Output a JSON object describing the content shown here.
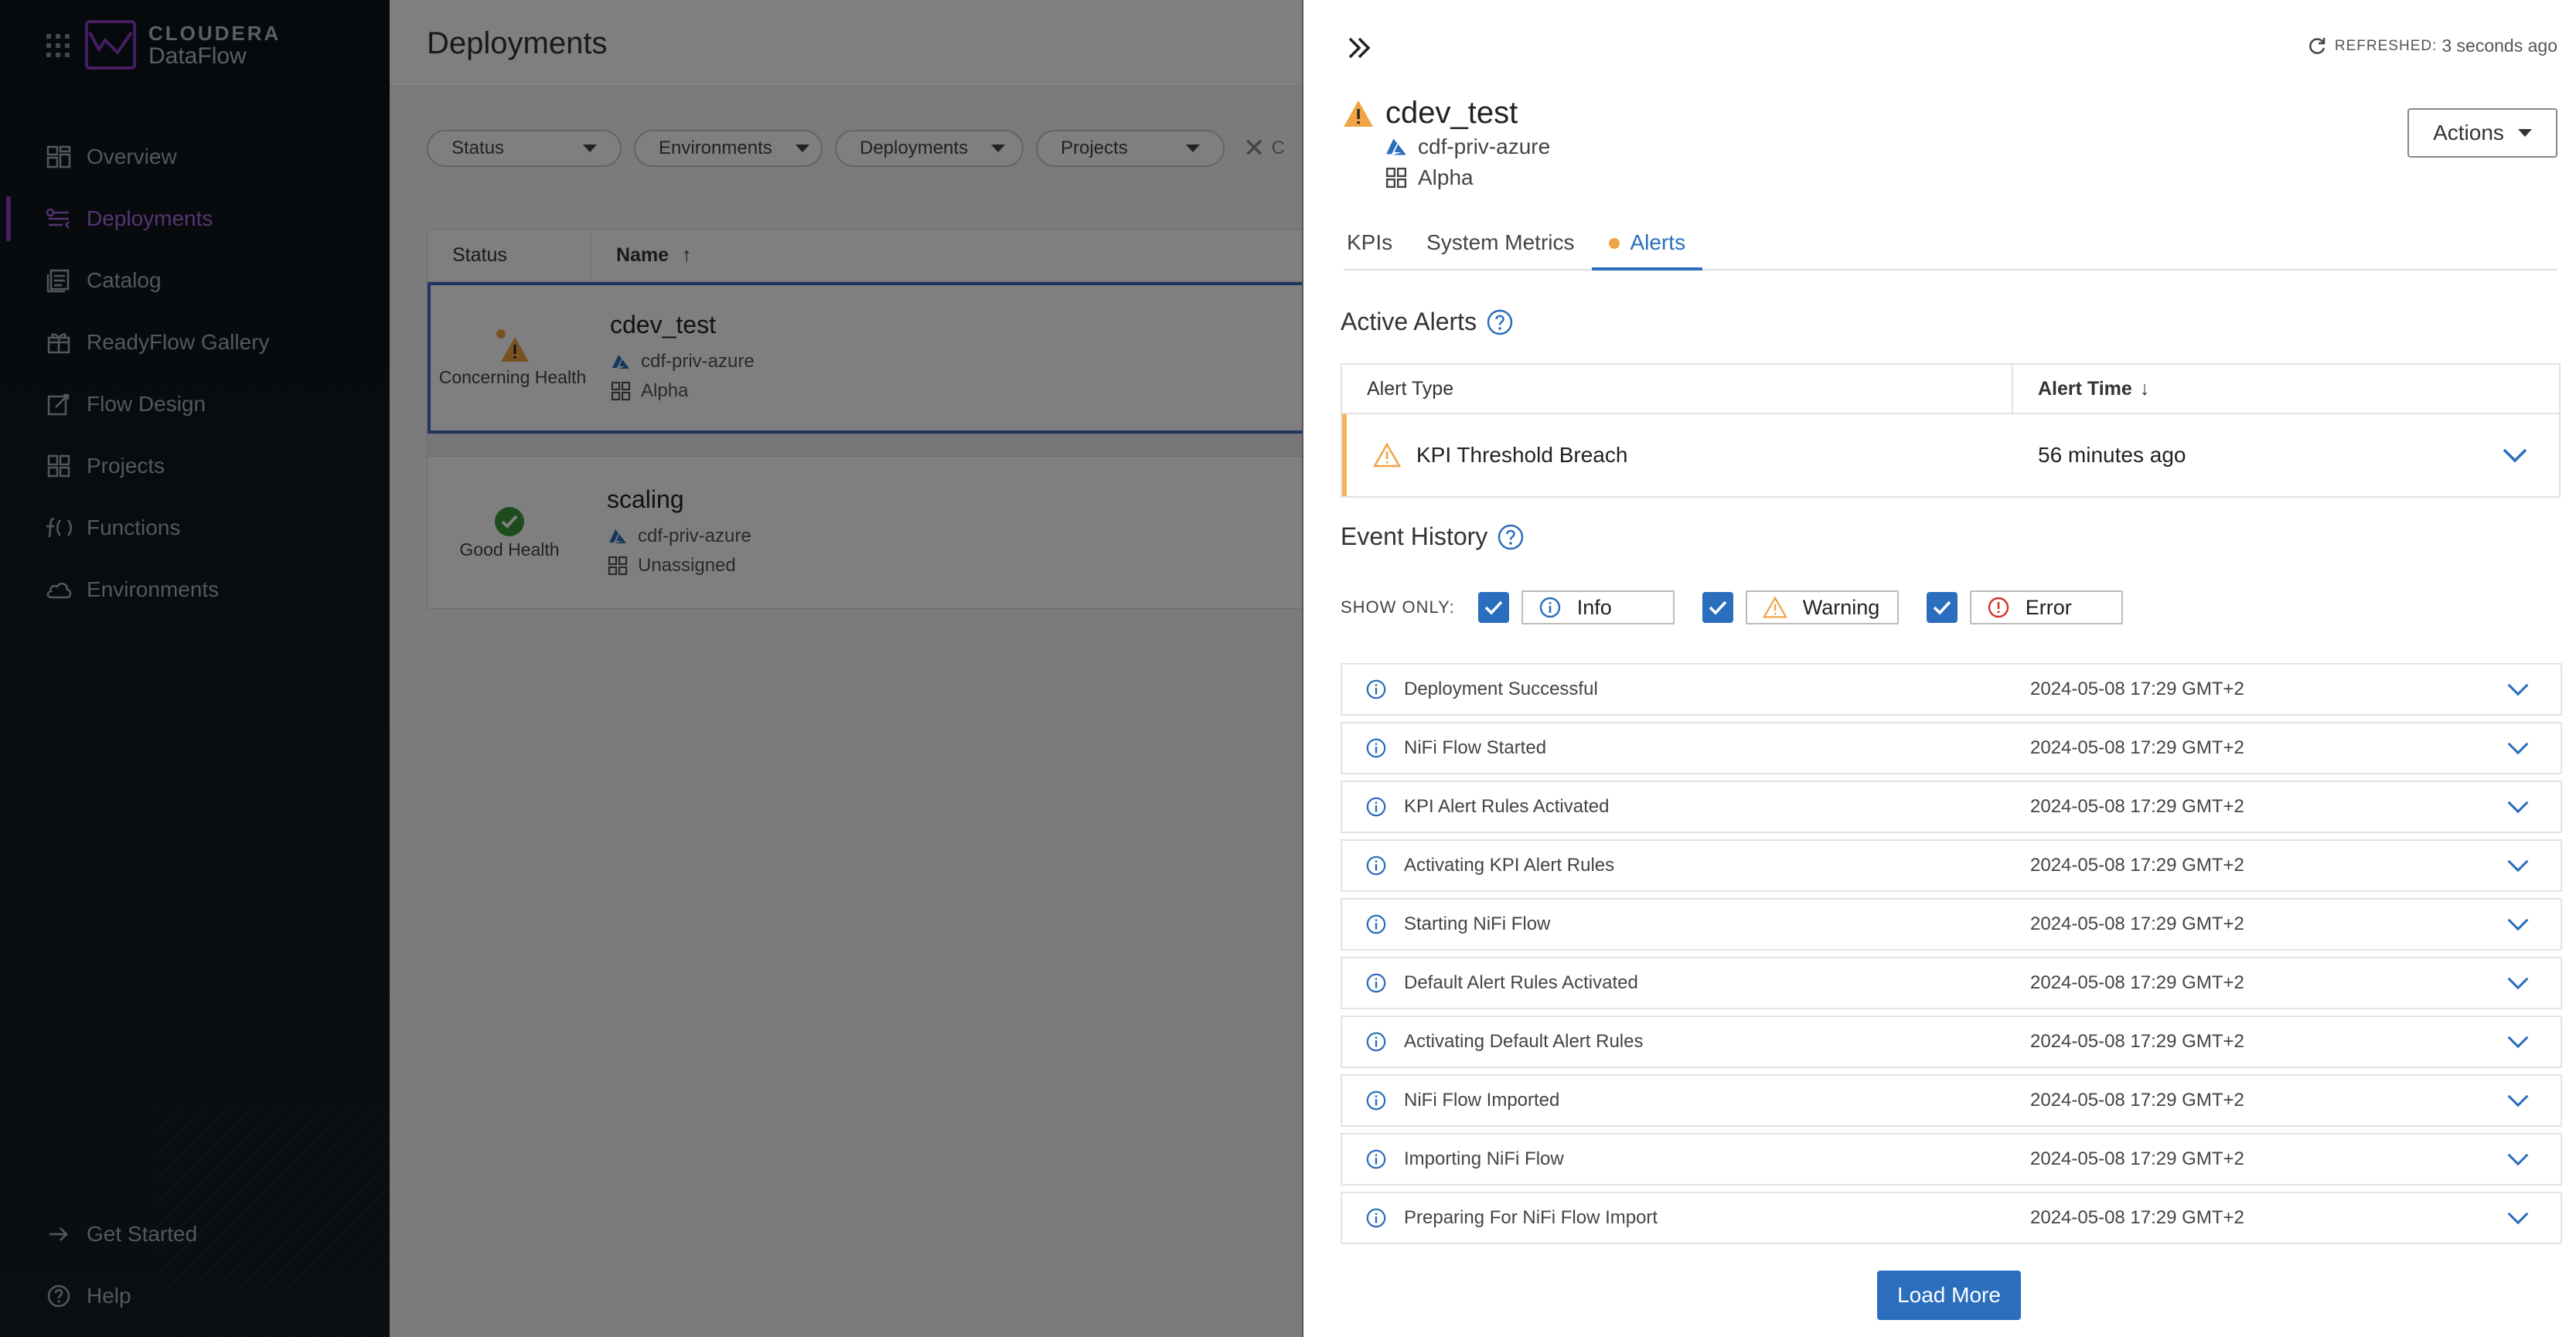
{
  "sidebar": {
    "logo_brand": "CLOUDERA",
    "logo_product": "DataFlow",
    "items": [
      {
        "label": "Overview",
        "icon": "overview-icon"
      },
      {
        "label": "Deployments",
        "icon": "deployments-icon",
        "active": true
      },
      {
        "label": "Catalog",
        "icon": "catalog-icon"
      },
      {
        "label": "ReadyFlow Gallery",
        "icon": "gallery-icon"
      },
      {
        "label": "Flow Design",
        "icon": "flow-design-icon"
      },
      {
        "label": "Projects",
        "icon": "projects-icon"
      },
      {
        "label": "Functions",
        "icon": "functions-icon"
      },
      {
        "label": "Environments",
        "icon": "cloud-icon"
      }
    ],
    "bottom": [
      {
        "label": "Get Started",
        "icon": "arrow-right-icon"
      },
      {
        "label": "Help",
        "icon": "help-icon"
      }
    ],
    "accent_color": "#8c3dc4"
  },
  "main": {
    "title": "Deployments",
    "filters": [
      "Status",
      "Environments",
      "Deployments",
      "Projects"
    ],
    "clear_label": "C",
    "table": {
      "col_status": "Status",
      "col_name": "Name",
      "rows": [
        {
          "status": "Concerning Health",
          "name": "cdev_test",
          "environment": "cdf-priv-azure",
          "project": "Alpha"
        },
        {
          "status": "Good Health",
          "name": "scaling",
          "environment": "cdf-priv-azure",
          "project": "Unassigned"
        }
      ]
    }
  },
  "panel": {
    "refreshed_label": "REFRESHED:",
    "refreshed_value": "3 seconds ago",
    "title": "cdev_test",
    "environment": "cdf-priv-azure",
    "project": "Alpha",
    "actions_label": "Actions",
    "tabs": [
      {
        "label": "KPIs"
      },
      {
        "label": "System Metrics"
      },
      {
        "label": "Alerts",
        "active": true
      }
    ],
    "active_alerts": {
      "title": "Active Alerts",
      "col_type": "Alert Type",
      "col_time": "Alert Time",
      "rows": [
        {
          "type": "KPI Threshold Breach",
          "time": "56 minutes ago"
        }
      ]
    },
    "event_history": {
      "title": "Event History",
      "show_only_label": "SHOW ONLY:",
      "filters": [
        {
          "label": "Info",
          "checked": true
        },
        {
          "label": "Warning",
          "checked": true
        },
        {
          "label": "Error",
          "checked": true
        }
      ],
      "events": [
        {
          "text": "Deployment Successful",
          "time": "2024-05-08 17:29 GMT+2"
        },
        {
          "text": "NiFi Flow Started",
          "time": "2024-05-08 17:29 GMT+2"
        },
        {
          "text": "KPI Alert Rules Activated",
          "time": "2024-05-08 17:29 GMT+2"
        },
        {
          "text": "Activating KPI Alert Rules",
          "time": "2024-05-08 17:29 GMT+2"
        },
        {
          "text": "Starting NiFi Flow",
          "time": "2024-05-08 17:29 GMT+2"
        },
        {
          "text": "Default Alert Rules Activated",
          "time": "2024-05-08 17:29 GMT+2"
        },
        {
          "text": "Activating Default Alert Rules",
          "time": "2024-05-08 17:29 GMT+2"
        },
        {
          "text": "NiFi Flow Imported",
          "time": "2024-05-08 17:29 GMT+2"
        },
        {
          "text": "Importing NiFi Flow",
          "time": "2024-05-08 17:29 GMT+2"
        },
        {
          "text": "Preparing For NiFi Flow Import",
          "time": "2024-05-08 17:29 GMT+2"
        }
      ]
    },
    "load_more_label": "Load More",
    "primary_color": "#2a6ebd",
    "warning_color": "#f0a446"
  }
}
